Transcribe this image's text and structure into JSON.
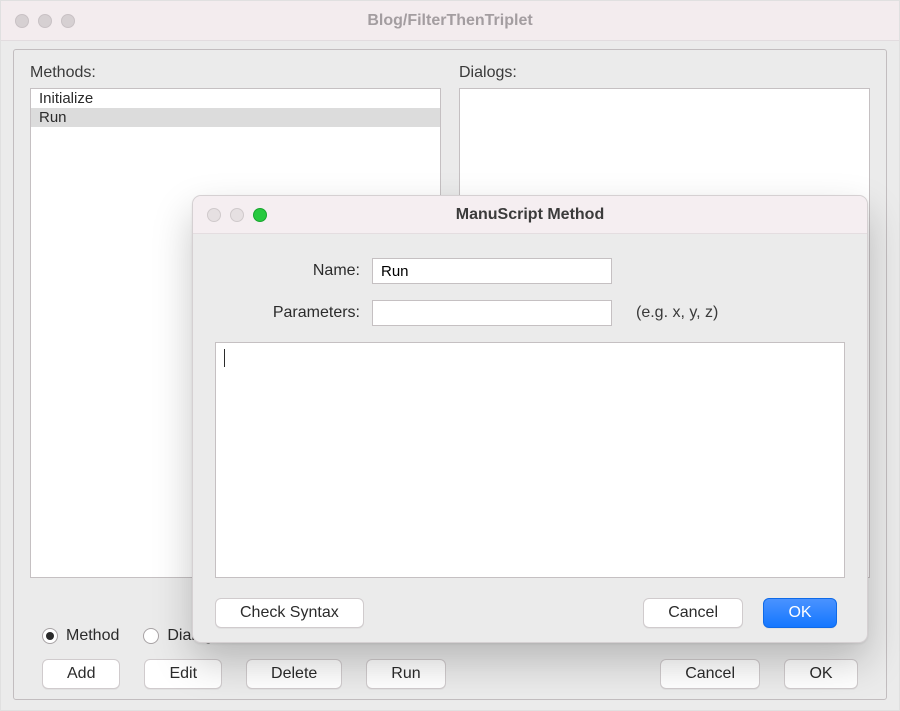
{
  "bg": {
    "title": "Blog/FilterThenTriplet",
    "methods_label": "Methods:",
    "dialogs_label": "Dialogs:",
    "methods": [
      "Initialize",
      "Run"
    ],
    "methods_selected_index": 1,
    "dialogs": [],
    "radios": {
      "method": "Method",
      "dialog": "Dialog",
      "selected": "method"
    },
    "buttons": {
      "add": "Add",
      "edit": "Edit",
      "delete": "Delete",
      "run": "Run",
      "cancel": "Cancel",
      "ok": "OK"
    }
  },
  "modal": {
    "title": "ManuScript Method",
    "name_label": "Name:",
    "name_value": "Run",
    "params_label": "Parameters:",
    "params_value": "",
    "params_hint": "(e.g. x, y, z)",
    "body_value": "",
    "buttons": {
      "check_syntax": "Check Syntax",
      "cancel": "Cancel",
      "ok": "OK"
    }
  }
}
